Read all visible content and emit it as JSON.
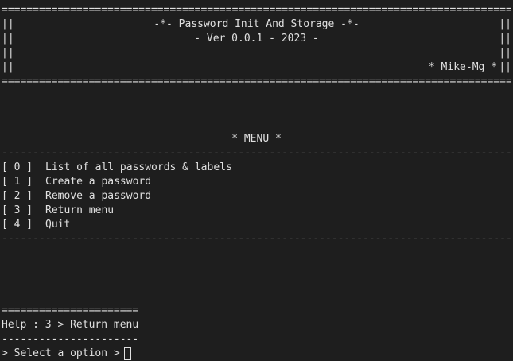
{
  "header": {
    "top_rule": "==================================================================================",
    "left_border": "||",
    "right_border": "||",
    "title": "-*- Password Init And Storage -*-",
    "version": "- Ver 0.0.1 - 2023 -",
    "author": "* Mike-Mg *",
    "bottom_rule": "=================================================================================="
  },
  "menu": {
    "title": "* MENU *",
    "top_rule": "----------------------------------------------------------------------------------",
    "items": [
      {
        "index": "[ 0 ]",
        "label": "List of all passwords & labels"
      },
      {
        "index": "[ 1 ]",
        "label": "Create a password"
      },
      {
        "index": "[ 2 ]",
        "label": "Remove a password"
      },
      {
        "index": "[ 3 ]",
        "label": "Return menu"
      },
      {
        "index": "[ 4 ]",
        "label": "Quit"
      }
    ],
    "bottom_rule": "----------------------------------------------------------------------------------"
  },
  "help": {
    "top_rule": "======================",
    "text": "Help : 3 > Return menu",
    "bottom_rule": "----------------------"
  },
  "prompt": {
    "text": "> Select a option >",
    "input_value": ""
  }
}
